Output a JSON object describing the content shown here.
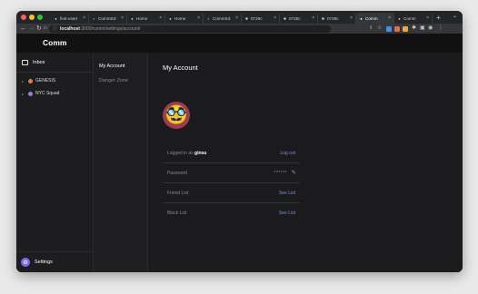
{
  "browser": {
    "traffic_colors": [
      "#ff5f57",
      "#febc2e",
      "#28c840"
    ],
    "tabs": [
      {
        "title": "fest-userr",
        "icon": "comm-icon",
        "active": false
      },
      {
        "title": "CommS3:",
        "icon": "github-icon",
        "active": false
      },
      {
        "title": "Home",
        "icon": "comm-icon",
        "active": false
      },
      {
        "title": "Home",
        "icon": "comm-icon",
        "active": false
      },
      {
        "title": "CommS3:",
        "icon": "github-icon",
        "active": false
      },
      {
        "title": "0728с",
        "icon": "globe-icon",
        "active": false
      },
      {
        "title": "0728с",
        "icon": "globe-icon",
        "active": false
      },
      {
        "title": "0728с",
        "icon": "globe-icon",
        "active": false
      },
      {
        "title": "Comm",
        "icon": "comm-icon",
        "active": true
      },
      {
        "title": "Comm",
        "icon": "comm-icon",
        "active": false
      }
    ],
    "new_tab": "+",
    "url_host": "localhost",
    "url_path": ":3000/comm/settings/account/"
  },
  "app": {
    "brand": "Comm",
    "nav": {
      "inbox_label": "Inbox",
      "communities": [
        {
          "name": "GENESIS",
          "color": "#e07a43"
        },
        {
          "name": "NYC Squad",
          "color": "#9b7de0"
        }
      ],
      "settings_label": "Settings"
    },
    "settings_menu": {
      "items": [
        {
          "label": "My Account",
          "selected": true
        },
        {
          "label": "Danger Zone",
          "selected": false
        }
      ]
    },
    "account": {
      "title": "My Account",
      "avatar_emoji": "🥸",
      "logged_in_prefix": "Logged in as",
      "username": "ginsu",
      "logout": "Log out",
      "password_label": "Password",
      "password_mask": "******",
      "friend_list_label": "Friend List",
      "block_list_label": "Block List",
      "see_list": "See List"
    }
  }
}
